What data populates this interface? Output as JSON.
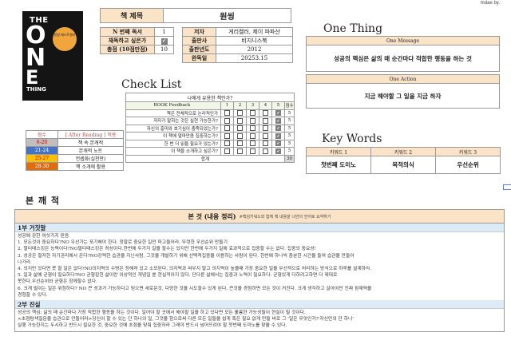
{
  "made_by": "mdae by.",
  "cover": {
    "the": "THE",
    "o": "O",
    "n": "N",
    "e": "E",
    "thing": "THING",
    "badge": "원씽 베스트셀러"
  },
  "book": {
    "title_label": "책 제목",
    "title": "원씽",
    "left_rows": [
      {
        "label": "N 번째 독서",
        "value": "1"
      },
      {
        "label": "재독하고 싶은가",
        "value": "✔"
      },
      {
        "label": "총점 (10점만점)",
        "value": "10"
      }
    ],
    "right_rows": [
      {
        "label": "저자",
        "value": "게리켈러, 제이 파파산"
      },
      {
        "label": "출판사",
        "value": "비지니스북"
      },
      {
        "label": "출판년도",
        "value": "2012"
      },
      {
        "label": "완독일",
        "value": "20253.15"
      }
    ]
  },
  "checklist": {
    "title": "Check List",
    "question": "나에게 유용한 책인가?",
    "feedback_label": "BOOK Feedback",
    "cols": [
      "1",
      "2",
      "3",
      "4",
      "5"
    ],
    "score_label": "점수",
    "rows": [
      {
        "q": "책은 전체적으로 논리적인가",
        "score": "5"
      },
      {
        "q": "저자가 말하는 것은 실현 가능한가?",
        "score": "5"
      },
      {
        "q": "자신의 흥미와 호기심이 충족되었는가?",
        "score": "5"
      },
      {
        "q": "이 책에 얼마만큼 집중하는가?",
        "score": "5"
      },
      {
        "q": "한 번 더 읽을 필요가 있는가?",
        "score": "5"
      },
      {
        "q": "이 책을 소개하고 싶은가?",
        "score": "5"
      }
    ],
    "total_label": "합계",
    "total": "30"
  },
  "legend": {
    "h1": "점수",
    "h2": "[ After Reading ] 적용",
    "rows": [
      {
        "range": "6-20",
        "desc": "책 속 본캐적"
      },
      {
        "range": "21-24",
        "desc": "본캐적 노트"
      },
      {
        "range": "25-27",
        "desc": "컨셉화(실천만)"
      },
      {
        "range": "28-30",
        "desc": "책 소개에 활용"
      }
    ]
  },
  "one_thing": {
    "title": "One Thing",
    "message_label": "One Message",
    "message": "성공의 핵심은 삶의 매 순간마다 적합한 행동을 하는 것",
    "action_label": "One Action",
    "action": "지금 해야할 그 일을 지금 하자"
  },
  "keywords": {
    "title": "Key Words",
    "heads": [
      "키워드 1",
      "키워드 2",
      "키워드 3"
    ],
    "values": [
      "첫번째 도미노",
      "목적의식",
      "우선순위"
    ]
  },
  "main": {
    "title": "본 깨 적",
    "header": "본 것 (내용 정리)",
    "header_note": "#핵심키워드와 함께 책 내용을 나만의 언어로 요약하기",
    "parts": [
      {
        "title": "1부 거짓말",
        "lines": [
          "성공에 관한 여섯가지 믿음",
          "1. 모든것이 중요하다?NO 우선가는 포기해야 한다. 정말로 중요한 일만 파고들어라. 뚜렷한 우선순위 만들기",
          "2. 멀티태스킹은 능력이다?NO멀티태스킹은 허상이다.한번에 두가지 일을 할수는 있지만 한번에 두가지 일에 효과적으로 집중할 수는 없다. 집중의 중요성!",
          "3. 성공은 철저한 자기관리에서 온다?NO강력한 습관을 지닌사람, 그것을 개발하기 위해 선택적집중을 이용하는 사람이 된다. 한번에 하나씩 충분한 시간을 들여 습관을 만들어",
          "나가라.",
          "4. 의지만 있다면 못 할 일은 없다?NO의지력의 수명은 정해져 있고 소모된다. 의지력과 싸우지 말고 의지력이 높을때 가장 중요한 일을 우선적으로 처리하는 방식으로 하루를 설계하라.",
          "5. 일과 삶에 균형이 필요하다?NO 균형잡힌 삶이란 이상적인 개념일 뿐 현실적이지 않다. 단다른 삶에서는 집중과 노력이 필요하다. 균형있게 다하려고하면 다 제대로",
          "못한다.우선순위와 균형은 함께할수 없다.",
          "6. 크게 벌이는 일은 위험하다? NO 큰 성과가 가능하다고 믿으면 새로운것, 다양한 것을 시도할수 있게 된다. 큰것을 경험하면 모든 것이 커진다. 크게 생각하고 살아야만 진짜 잠재력을",
          "경험할 수 있다."
        ]
      },
      {
        "title": "2부 진실",
        "lines": [
          "성공의 핵심: 삶의 매 순간마다 가장 적합한 행동을 하는 것이다. 일어야 할 곳에서 해야할 일을 하고 있다면 모든 훌륭한 가능성들이 현실이 될 것이다.",
          "<초점탐색질문을 습관으로 만들어라>당신이 할 수 있는 단 하나의 일, 그것을 함으로써 다른 모든 일들을 쉽게 혹은 필요 없게 만들 바로 그 '일은 무엇인가?'자신만의 단 하나'",
          "실행 가능한지는 두시하고 반드시 필요한 것, 중요한 것에 초점을 맞춰 집중하라 그래야 반드시 넘어뜨려야 할 첫번째 도미노를 찾을 수 있다."
        ]
      }
    ]
  }
}
